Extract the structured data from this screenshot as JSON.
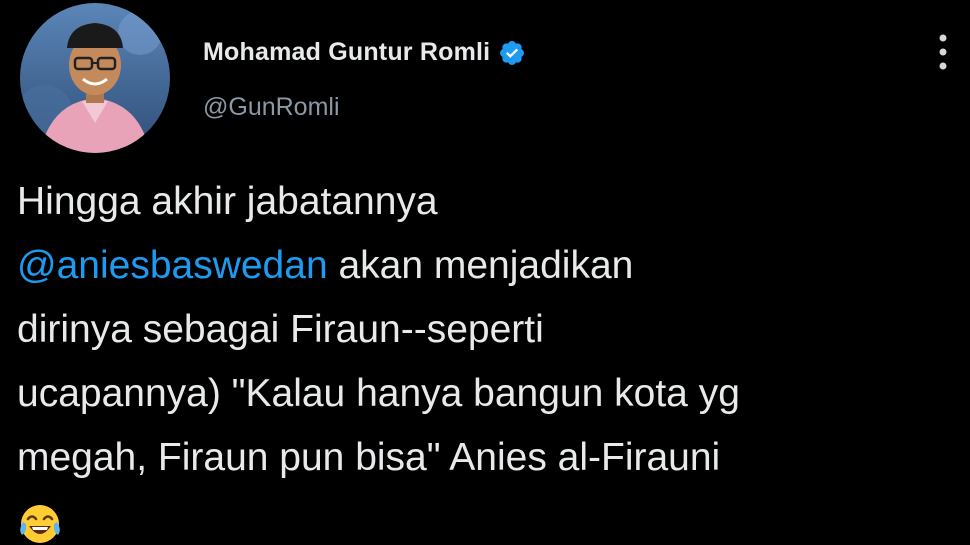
{
  "author": {
    "display_name": "Mohamad Guntur Romli",
    "handle": "@GunRomli",
    "verified": true
  },
  "tweet": {
    "lines": [
      {
        "text": "Hingga akhir jabatannya"
      },
      {
        "mention": "@aniesbaswedan",
        "rest": " akan menjadikan"
      },
      {
        "text": "dirinya sebagai Firaun--seperti"
      },
      {
        "text": "ucapannya) \"Kalau hanya bangun kota yg"
      },
      {
        "text": "megah, Firaun pun bisa\" Anies al-Firauni"
      }
    ],
    "emoji": "face-with-tears-of-joy-icon"
  },
  "colors": {
    "background": "#000000",
    "text": "#e7e9ea",
    "secondary": "#8b98a5",
    "accent": "#1d9bf0"
  },
  "icons": {
    "verified": "verified-badge-icon",
    "more": "more-options-icon"
  }
}
